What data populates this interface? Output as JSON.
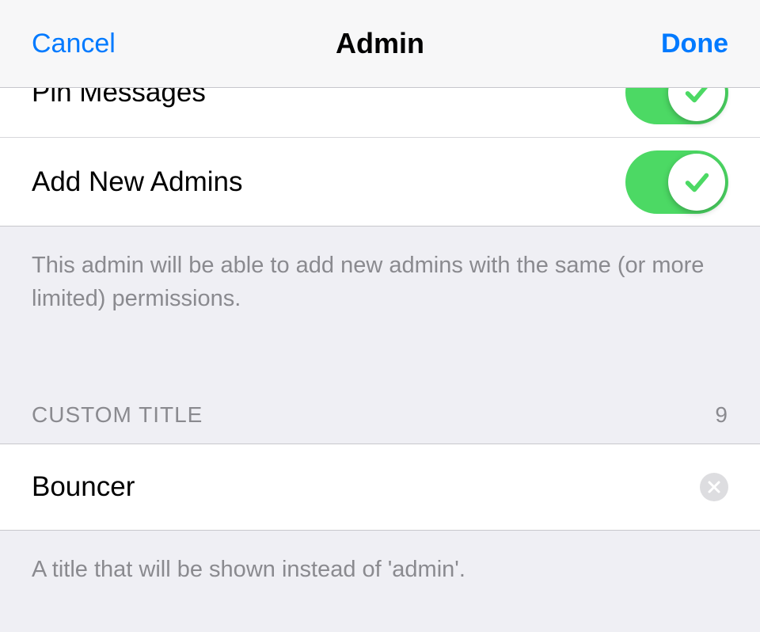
{
  "navbar": {
    "cancel_label": "Cancel",
    "title": "Admin",
    "done_label": "Done"
  },
  "permissions": {
    "pin_messages": {
      "label": "Pin Messages",
      "enabled": true
    },
    "add_new_admins": {
      "label": "Add New Admins",
      "enabled": true,
      "footer": "This admin will be able to add new admins with the same (or more limited) permissions."
    }
  },
  "custom_title": {
    "header": "CUSTOM TITLE",
    "remaining": "9",
    "value": "Bouncer",
    "footer": "A title that will be shown instead of 'admin'."
  },
  "colors": {
    "link": "#007aff",
    "toggle_on": "#4cd964",
    "bg": "#efeff4",
    "muted": "#8a8a8f"
  }
}
